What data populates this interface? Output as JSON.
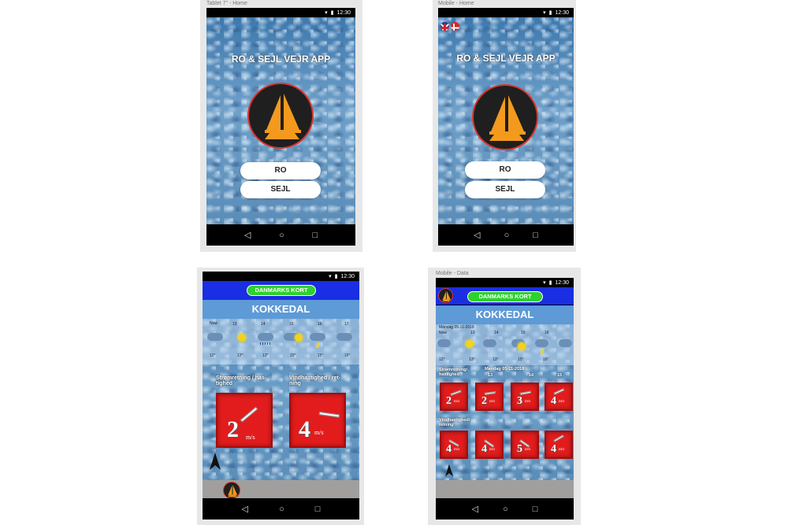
{
  "frames": {
    "tablet_home": {
      "label": "Tablet 7\" - Home",
      "time": "12:30"
    },
    "mobile_home": {
      "label": "Mobile - Home",
      "time": "12:30"
    },
    "tablet_data": {
      "time": "12:30"
    },
    "mobile_data": {
      "label": "Mobile - Data",
      "time": "12:30"
    }
  },
  "home": {
    "title": "RO & SEJL VEJR APP",
    "ro_label": "RO",
    "sejl_label": "SEJL"
  },
  "navbar": {
    "back": "◁",
    "home": "○",
    "recents": "□"
  },
  "data": {
    "map_button": "DANMARKS KORT",
    "city": "KOKKEDAL",
    "date": "Mandag 05-11-2018",
    "forecast_times": [
      "Now",
      "13",
      "14",
      "15",
      "16",
      "17"
    ],
    "forecast_times_mobile": [
      "Now",
      "13",
      "14",
      "15",
      "16"
    ],
    "forecast_temps": [
      "12°",
      "13°",
      "13°",
      "15°",
      "15°",
      "16°"
    ],
    "forecast_temps_mobile": [
      "12°",
      "13°",
      "13°",
      "15°",
      "16°"
    ],
    "current_label": "Strømretning / has-tighed",
    "wind_label": "Vindhastighed / ret-ning",
    "current_value": "2",
    "wind_value": "4",
    "unit": "m/s",
    "mobile_current_label": "Strømretning/ hastighed",
    "mobile_wind_label": "Vindhastighed/ retning",
    "mobile_hours": [
      "13",
      "14",
      "15"
    ],
    "mobile_current_values": [
      "2",
      "2",
      "3",
      "4"
    ],
    "mobile_wind_values": [
      "4",
      "4",
      "5",
      "4"
    ],
    "mobile_unit": "m/s"
  },
  "colors": {
    "accent_red": "#e21c1c",
    "map_button_green": "#2ed12e",
    "top_band_blue": "#1a2ee3",
    "city_band_blue": "#5d9ad6",
    "logo_orange": "#f39a1e"
  },
  "icons": [
    "wifi-icon",
    "signal-icon",
    "battery-icon",
    "back-icon",
    "home-icon",
    "recents-icon",
    "sailboat-logo-icon",
    "uk-flag-icon",
    "danish-flag-icon",
    "cloud-icon",
    "sun-icon",
    "lightning-icon",
    "arrow-icon",
    "north-arrow-icon"
  ]
}
